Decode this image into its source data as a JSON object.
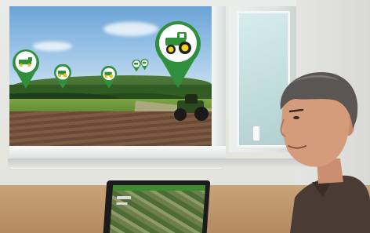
{
  "scene": {
    "pins": [
      {
        "icon": "combine-icon",
        "color": "#2e8b3a"
      },
      {
        "icon": "tractor-icon",
        "color": "#2e8b3a"
      },
      {
        "icon": "tractor-icon",
        "color": "#2e8b3a"
      },
      {
        "icon": "tractor-icon",
        "color": "#2e8b3a"
      },
      {
        "icon": "tractor-icon",
        "color": "#2e8b3a"
      },
      {
        "icon": "tractor-icon",
        "color": "#2e8b3a"
      }
    ],
    "colors": {
      "brand_green": "#3a9a3a",
      "tractor_yellow": "#f2d21b"
    }
  }
}
